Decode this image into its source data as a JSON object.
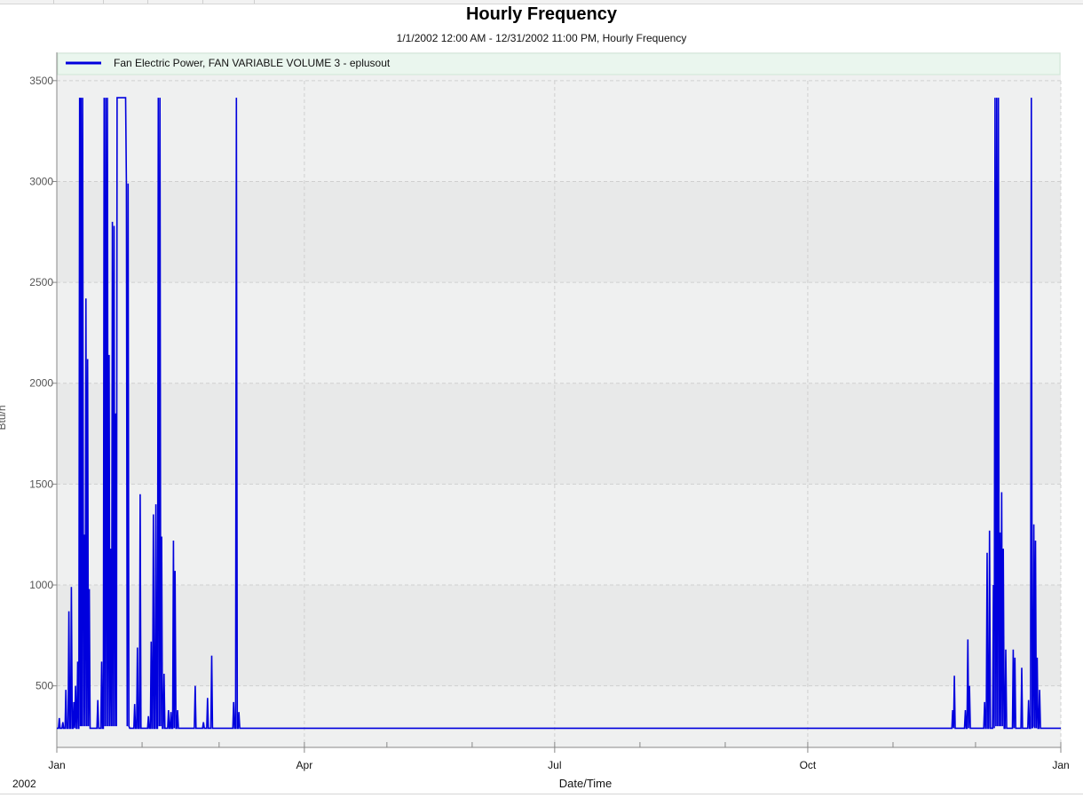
{
  "chart_data": {
    "type": "line",
    "title": "Hourly Frequency",
    "subtitle": "1/1/2002 12:00 AM - 12/31/2002 11:00 PM, Hourly Frequency",
    "xlabel": "Date/Time",
    "ylabel": "Btu/h",
    "year_label": "2002",
    "x_tick_labels": [
      "Jan",
      "Apr",
      "Jul",
      "Oct",
      "Jan"
    ],
    "x_tick_days": [
      0,
      90,
      181,
      273,
      365
    ],
    "xlim": [
      0,
      365
    ],
    "y_ticks": [
      500,
      1000,
      1500,
      2000,
      2500,
      3000,
      3500
    ],
    "ylim": [
      195,
      3640
    ],
    "grid": true,
    "legend_position": "top",
    "series": [
      {
        "name": "Fan Electric Power, FAN VARIABLE VOLUME 3 - eplusout",
        "color": "#0000dd",
        "x_unit": "day of year 2002",
        "points": [
          [
            0.0,
            290
          ],
          [
            0.6,
            290
          ],
          [
            0.9,
            340
          ],
          [
            1.2,
            290
          ],
          [
            1.9,
            290
          ],
          [
            2.2,
            320
          ],
          [
            2.5,
            290
          ],
          [
            3.0,
            290
          ],
          [
            3.3,
            480
          ],
          [
            3.6,
            290
          ],
          [
            4.1,
            290
          ],
          [
            4.4,
            870
          ],
          [
            4.7,
            290
          ],
          [
            5.0,
            290
          ],
          [
            5.3,
            990
          ],
          [
            5.6,
            290
          ],
          [
            5.9,
            290
          ],
          [
            6.2,
            420
          ],
          [
            6.5,
            290
          ],
          [
            6.8,
            500
          ],
          [
            7.1,
            290
          ],
          [
            7.3,
            290
          ],
          [
            7.6,
            620
          ],
          [
            7.9,
            290
          ],
          [
            8.0,
            290
          ],
          [
            8.3,
            3415
          ],
          [
            8.6,
            300
          ],
          [
            8.8,
            3415
          ],
          [
            9.1,
            300
          ],
          [
            9.4,
            3415
          ],
          [
            9.7,
            300
          ],
          [
            10.0,
            1250
          ],
          [
            10.3,
            300
          ],
          [
            10.6,
            2420
          ],
          [
            10.9,
            300
          ],
          [
            11.2,
            2120
          ],
          [
            11.5,
            300
          ],
          [
            11.8,
            980
          ],
          [
            12.1,
            290
          ],
          [
            12.8,
            290
          ],
          [
            14.6,
            290
          ],
          [
            14.9,
            430
          ],
          [
            15.2,
            290
          ],
          [
            16.0,
            290
          ],
          [
            16.3,
            620
          ],
          [
            16.6,
            290
          ],
          [
            16.9,
            290
          ],
          [
            17.2,
            3415
          ],
          [
            17.5,
            300
          ],
          [
            17.8,
            3415
          ],
          [
            18.1,
            300
          ],
          [
            18.4,
            3415
          ],
          [
            18.7,
            300
          ],
          [
            19.0,
            2140
          ],
          [
            19.3,
            300
          ],
          [
            19.6,
            1180
          ],
          [
            19.9,
            300
          ],
          [
            20.2,
            2800
          ],
          [
            20.5,
            300
          ],
          [
            20.8,
            2780
          ],
          [
            21.1,
            300
          ],
          [
            21.4,
            1850
          ],
          [
            21.7,
            300
          ],
          [
            21.9,
            3415
          ],
          [
            25.0,
            3415
          ],
          [
            25.3,
            2990
          ],
          [
            25.6,
            300
          ],
          [
            25.9,
            2990
          ],
          [
            26.2,
            300
          ],
          [
            26.5,
            290
          ],
          [
            27.5,
            290
          ],
          [
            28.0,
            290
          ],
          [
            28.3,
            410
          ],
          [
            28.6,
            290
          ],
          [
            29.0,
            290
          ],
          [
            29.3,
            690
          ],
          [
            29.6,
            290
          ],
          [
            30.0,
            290
          ],
          [
            30.3,
            1450
          ],
          [
            30.6,
            290
          ],
          [
            31.0,
            290
          ],
          [
            32.0,
            290
          ],
          [
            33.0,
            290
          ],
          [
            33.3,
            350
          ],
          [
            33.6,
            290
          ],
          [
            34.0,
            290
          ],
          [
            34.3,
            720
          ],
          [
            34.6,
            290
          ],
          [
            34.8,
            290
          ],
          [
            35.1,
            1350
          ],
          [
            35.4,
            290
          ],
          [
            35.7,
            290
          ],
          [
            36.0,
            1400
          ],
          [
            36.3,
            290
          ],
          [
            36.6,
            290
          ],
          [
            36.9,
            3415
          ],
          [
            37.2,
            300
          ],
          [
            37.5,
            3415
          ],
          [
            37.8,
            300
          ],
          [
            38.1,
            1240
          ],
          [
            38.4,
            290
          ],
          [
            38.7,
            290
          ],
          [
            39.0,
            560
          ],
          [
            39.3,
            290
          ],
          [
            40.0,
            290
          ],
          [
            40.3,
            290
          ],
          [
            40.6,
            380
          ],
          [
            40.9,
            290
          ],
          [
            41.2,
            290
          ],
          [
            41.5,
            370
          ],
          [
            41.8,
            290
          ],
          [
            42.1,
            290
          ],
          [
            42.4,
            1220
          ],
          [
            42.7,
            290
          ],
          [
            43.0,
            1070
          ],
          [
            43.3,
            290
          ],
          [
            43.6,
            290
          ],
          [
            43.9,
            380
          ],
          [
            44.2,
            290
          ],
          [
            45.0,
            290
          ],
          [
            50.0,
            290
          ],
          [
            50.3,
            500
          ],
          [
            50.6,
            290
          ],
          [
            51.0,
            290
          ],
          [
            53.0,
            290
          ],
          [
            53.3,
            320
          ],
          [
            53.6,
            290
          ],
          [
            54.5,
            290
          ],
          [
            54.8,
            440
          ],
          [
            55.1,
            290
          ],
          [
            56.0,
            290
          ],
          [
            56.3,
            650
          ],
          [
            56.6,
            290
          ],
          [
            57.0,
            290
          ],
          [
            64.0,
            290
          ],
          [
            64.3,
            420
          ],
          [
            64.6,
            290
          ],
          [
            65.0,
            290
          ],
          [
            65.3,
            3415
          ],
          [
            65.6,
            290
          ],
          [
            65.9,
            290
          ],
          [
            66.2,
            370
          ],
          [
            66.5,
            290
          ],
          [
            67.0,
            290
          ],
          [
            100.0,
            290
          ],
          [
            150.0,
            290
          ],
          [
            200.0,
            290
          ],
          [
            250.0,
            290
          ],
          [
            300.0,
            290
          ],
          [
            325.0,
            290
          ],
          [
            325.4,
            290
          ],
          [
            325.7,
            380
          ],
          [
            326.0,
            290
          ],
          [
            326.3,
            550
          ],
          [
            326.6,
            290
          ],
          [
            327.0,
            290
          ],
          [
            330.0,
            290
          ],
          [
            330.3,
            380
          ],
          [
            330.6,
            290
          ],
          [
            330.9,
            290
          ],
          [
            331.2,
            730
          ],
          [
            331.5,
            290
          ],
          [
            331.8,
            500
          ],
          [
            332.1,
            290
          ],
          [
            337.0,
            290
          ],
          [
            337.3,
            420
          ],
          [
            337.6,
            290
          ],
          [
            337.9,
            290
          ],
          [
            338.2,
            1160
          ],
          [
            338.5,
            290
          ],
          [
            338.8,
            290
          ],
          [
            339.1,
            1270
          ],
          [
            339.4,
            290
          ],
          [
            340.0,
            290
          ],
          [
            340.2,
            290
          ],
          [
            340.5,
            1000
          ],
          [
            340.8,
            290
          ],
          [
            341.1,
            3415
          ],
          [
            341.4,
            300
          ],
          [
            341.7,
            3415
          ],
          [
            342.0,
            300
          ],
          [
            342.3,
            3415
          ],
          [
            342.6,
            300
          ],
          [
            342.9,
            1260
          ],
          [
            343.2,
            300
          ],
          [
            343.5,
            1460
          ],
          [
            343.8,
            300
          ],
          [
            344.1,
            1180
          ],
          [
            344.4,
            290
          ],
          [
            344.7,
            290
          ],
          [
            345.0,
            680
          ],
          [
            345.3,
            290
          ],
          [
            345.6,
            290
          ],
          [
            346.0,
            290
          ],
          [
            347.4,
            290
          ],
          [
            347.7,
            680
          ],
          [
            348.0,
            290
          ],
          [
            348.3,
            640
          ],
          [
            348.6,
            290
          ],
          [
            349.0,
            290
          ],
          [
            350.5,
            290
          ],
          [
            350.8,
            590
          ],
          [
            351.1,
            290
          ],
          [
            351.4,
            290
          ],
          [
            352.0,
            290
          ],
          [
            352.3,
            290
          ],
          [
            353.0,
            290
          ],
          [
            353.3,
            430
          ],
          [
            353.6,
            290
          ],
          [
            354.0,
            290
          ],
          [
            354.3,
            3415
          ],
          [
            354.6,
            290
          ],
          [
            354.9,
            300
          ],
          [
            355.2,
            1300
          ],
          [
            355.5,
            290
          ],
          [
            355.8,
            1220
          ],
          [
            356.1,
            290
          ],
          [
            356.4,
            640
          ],
          [
            356.7,
            290
          ],
          [
            357.0,
            290
          ],
          [
            357.3,
            480
          ],
          [
            357.6,
            290
          ],
          [
            358.0,
            290
          ],
          [
            365.0,
            290
          ]
        ]
      }
    ]
  }
}
